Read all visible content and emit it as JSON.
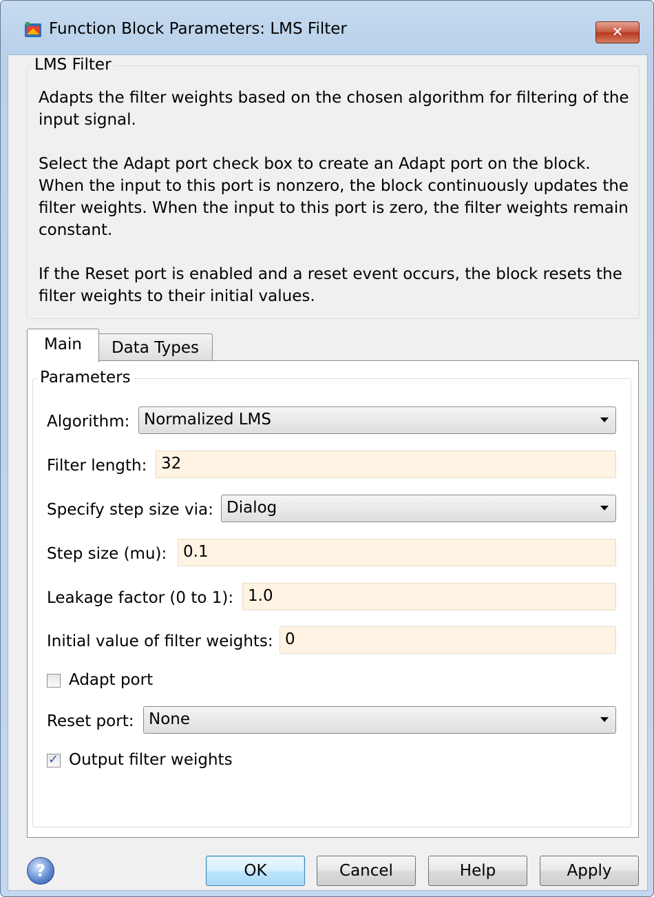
{
  "window": {
    "title": "Function Block Parameters: LMS Filter",
    "close_label": "✕"
  },
  "description": {
    "group_title": "LMS Filter",
    "paragraphs": [
      "Adapts the filter weights based on the chosen algorithm for filtering of the input signal.",
      "Select the Adapt port check box to create an Adapt port on the block. When the input to this port is nonzero, the block continuously updates the filter weights. When the input to this port is zero, the filter weights remain constant.",
      "If the Reset port is enabled and a reset event occurs, the block resets the filter weights to their initial values."
    ]
  },
  "tabs": [
    {
      "label": "Main",
      "selected": true
    },
    {
      "label": "Data Types",
      "selected": false
    }
  ],
  "parameters": {
    "group_title": "Parameters",
    "algorithm": {
      "label": "Algorithm:",
      "value": "Normalized LMS"
    },
    "filter_length": {
      "label": "Filter length:",
      "value": "32"
    },
    "step_size_source": {
      "label": "Specify step size via:",
      "value": "Dialog"
    },
    "step_size": {
      "label": "Step size (mu):",
      "value": "0.1"
    },
    "leakage_factor": {
      "label": "Leakage factor (0 to 1):",
      "value": "1.0"
    },
    "initial_weights": {
      "label": "Initial value of filter weights:",
      "value": "0"
    },
    "adapt_port": {
      "label": "Adapt port",
      "checked": false
    },
    "reset_port": {
      "label": "Reset port:",
      "value": "None"
    },
    "output_weights": {
      "label": "Output filter weights",
      "checked": true,
      "mark": "✓"
    }
  },
  "buttons": {
    "help_icon": "?",
    "ok": "OK",
    "cancel": "Cancel",
    "help": "Help",
    "apply": "Apply"
  },
  "colors": {
    "edit_background": "#fff3e3",
    "ok_button_border": "#3c7fb1",
    "title_bar": "#b9d1ea"
  }
}
